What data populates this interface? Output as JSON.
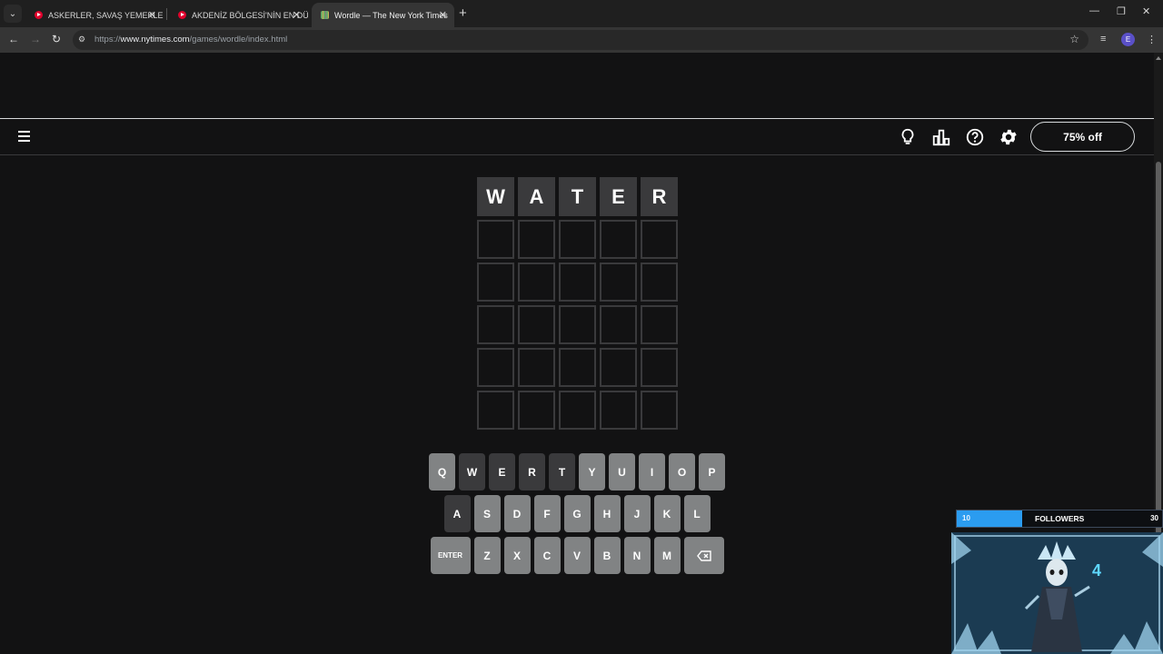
{
  "browser": {
    "tabs": [
      {
        "title": "ASKERLER, SAVAŞ YEMEKLERİNİ",
        "favicon": "youtube-icon",
        "active": false
      },
      {
        "title": "AKDENİZ BÖLGESİ'NİN EN DÜŞ",
        "favicon": "youtube-icon",
        "active": false
      },
      {
        "title": "Wordle — The New York Times",
        "favicon": "wordle-icon",
        "active": true
      }
    ],
    "url_prefix": "https://",
    "url_host": "www.nytimes.com",
    "url_path": "/games/wordle/index.html",
    "profile_initial": "E"
  },
  "header": {
    "promo_label": "75% off",
    "icons": [
      "hint-lightbulb-icon",
      "statistics-icon",
      "help-icon",
      "settings-gear-icon"
    ]
  },
  "board": {
    "rows": [
      [
        "W",
        "A",
        "T",
        "E",
        "R"
      ],
      [
        "",
        "",
        "",
        "",
        ""
      ],
      [
        "",
        "",
        "",
        "",
        ""
      ],
      [
        "",
        "",
        "",
        "",
        ""
      ],
      [
        "",
        "",
        "",
        "",
        ""
      ],
      [
        "",
        "",
        "",
        "",
        ""
      ]
    ]
  },
  "keyboard": {
    "rows": [
      [
        "Q",
        "W",
        "E",
        "R",
        "T",
        "Y",
        "U",
        "I",
        "O",
        "P"
      ],
      [
        "A",
        "S",
        "D",
        "F",
        "G",
        "H",
        "J",
        "K",
        "L"
      ],
      [
        "ENTER",
        "Z",
        "X",
        "C",
        "V",
        "B",
        "N",
        "M",
        "backspace"
      ]
    ],
    "absent_keys": [
      "W",
      "E",
      "R",
      "T",
      "A"
    ],
    "colors": {
      "key": "#818384",
      "absent": "#3a3a3c",
      "board_bg": "#121213"
    }
  },
  "overlay": {
    "goal_min": "10",
    "goal_title": "FOLLOWERS",
    "goal_max": "30",
    "goal_progress": 0.32,
    "cam_counter": "4"
  }
}
